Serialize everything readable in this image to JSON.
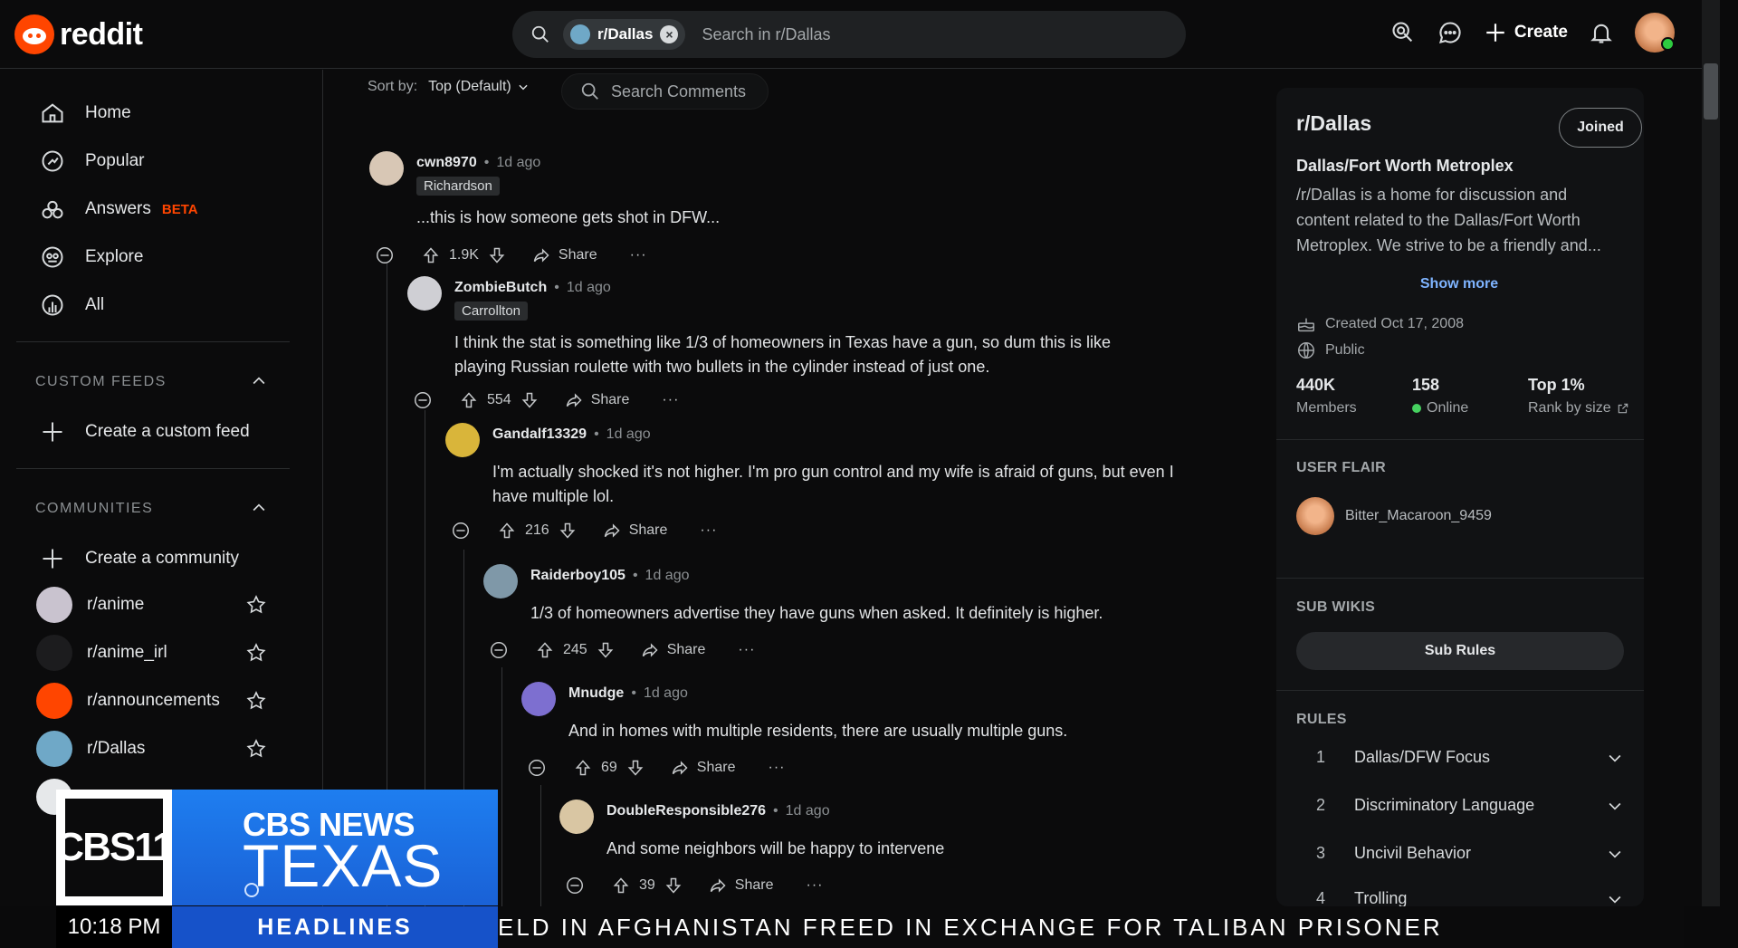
{
  "app": {
    "logo_text": "reddit"
  },
  "search": {
    "scope_chip": "r/Dallas",
    "placeholder": "Search in r/Dallas"
  },
  "topbar": {
    "create_label": "Create"
  },
  "sidebar": {
    "nav": [
      {
        "label": "Home",
        "icon": "home-icon"
      },
      {
        "label": "Popular",
        "icon": "popular-icon"
      },
      {
        "label": "Answers",
        "icon": "answers-icon",
        "badge": "BETA"
      },
      {
        "label": "Explore",
        "icon": "explore-icon"
      },
      {
        "label": "All",
        "icon": "all-icon"
      }
    ],
    "custom_feeds_heading": "CUSTOM FEEDS",
    "create_feed_label": "Create a custom feed",
    "communities_heading": "COMMUNITIES",
    "create_community_label": "Create a community",
    "communities": [
      {
        "name": "r/anime",
        "color": "#c9c3cf"
      },
      {
        "name": "r/anime_irl",
        "color": "#1c1c1e"
      },
      {
        "name": "r/announcements",
        "color": "#ff4500"
      },
      {
        "name": "r/Dallas",
        "color": "#6fa8c7"
      }
    ]
  },
  "main": {
    "sort_label": "Sort by:",
    "sort_value": "Top (Default)",
    "search_comments_label": "Search Comments",
    "share_label": "Share",
    "comments": [
      {
        "user": "cwn8970",
        "age": "1d ago",
        "flair": "Richardson",
        "lines": [
          "...this is how someone gets shot in DFW..."
        ],
        "votes": "1.9K",
        "avatar_color": "#d8c7b5"
      },
      {
        "user": "ZombieButch",
        "age": "1d ago",
        "flair": "Carrollton",
        "lines": [
          "I think the stat is something like 1/3 of homeowners in Texas have a gun, so dum          this is like",
          "playing Russian roulette with two bullets in the cylinder instead of just one."
        ],
        "votes": "554",
        "avatar_color": "#cfcfd4"
      },
      {
        "user": "Gandalf13329",
        "age": "1d ago",
        "flair": "",
        "lines": [
          "I'm actually shocked it's not higher. I'm pro gun control and my wife is afraid of guns, but even I",
          "have multiple lol."
        ],
        "votes": "216",
        "avatar_color": "#d9b53a"
      },
      {
        "user": "Raiderboy105",
        "age": "1d ago",
        "flair": "",
        "lines": [
          "1/3 of homeowners advertise they have guns when asked. It definitely is higher."
        ],
        "votes": "245",
        "avatar_color": "#7f98a8"
      },
      {
        "user": "Mnudge",
        "age": "1d ago",
        "flair": "",
        "lines": [
          "And in homes with multiple residents, there are usually multiple guns."
        ],
        "votes": "69",
        "avatar_color": "#7d6fd0"
      },
      {
        "user": "DoubleResponsible276",
        "age": "1d ago",
        "flair": "",
        "lines": [
          "And some neighbors will be happy to intervene"
        ],
        "votes": "39",
        "avatar_color": "#d9c6a3"
      }
    ]
  },
  "subreddit": {
    "name": "r/Dallas",
    "joined_label": "Joined",
    "title": "Dallas/Fort Worth Metroplex",
    "description": "/r/Dallas is a home for discussion and content related to the Dallas/Fort Worth Metroplex. We strive to be a friendly and...",
    "show_more": "Show more",
    "created": "Created Oct 17, 2008",
    "visibility": "Public",
    "stats": [
      {
        "value": "440K",
        "label": "Members"
      },
      {
        "value": "158",
        "label": "Online"
      },
      {
        "value": "Top 1%",
        "label": "Rank by size"
      }
    ],
    "user_flair_heading": "USER FLAIR",
    "user_flair_name": "Bitter_Macaroon_9459",
    "sub_wikis_heading": "SUB WIKIS",
    "sub_rules_label": "Sub Rules",
    "rules_heading": "RULES",
    "rules": [
      {
        "num": "1",
        "label": "Dallas/DFW Focus"
      },
      {
        "num": "2",
        "label": "Discriminatory Language"
      },
      {
        "num": "3",
        "label": "Uncivil Behavior"
      },
      {
        "num": "4",
        "label": "Trolling"
      }
    ]
  },
  "broadcast": {
    "logo_text": "CBS11",
    "brand_top": "CBS NEWS",
    "brand_bottom": "TEXAS",
    "time": "10:18 PM",
    "headlines_label": "HEADLINES",
    "ticker": "ELD IN AFGHANISTAN FREED IN EXCHANGE FOR TALIBAN PRISONER"
  },
  "colors": {
    "accent": "#ff4500",
    "link": "#7fb4ff",
    "cbs_blue": "#1e7ef0",
    "background": "#0b0b0c"
  }
}
